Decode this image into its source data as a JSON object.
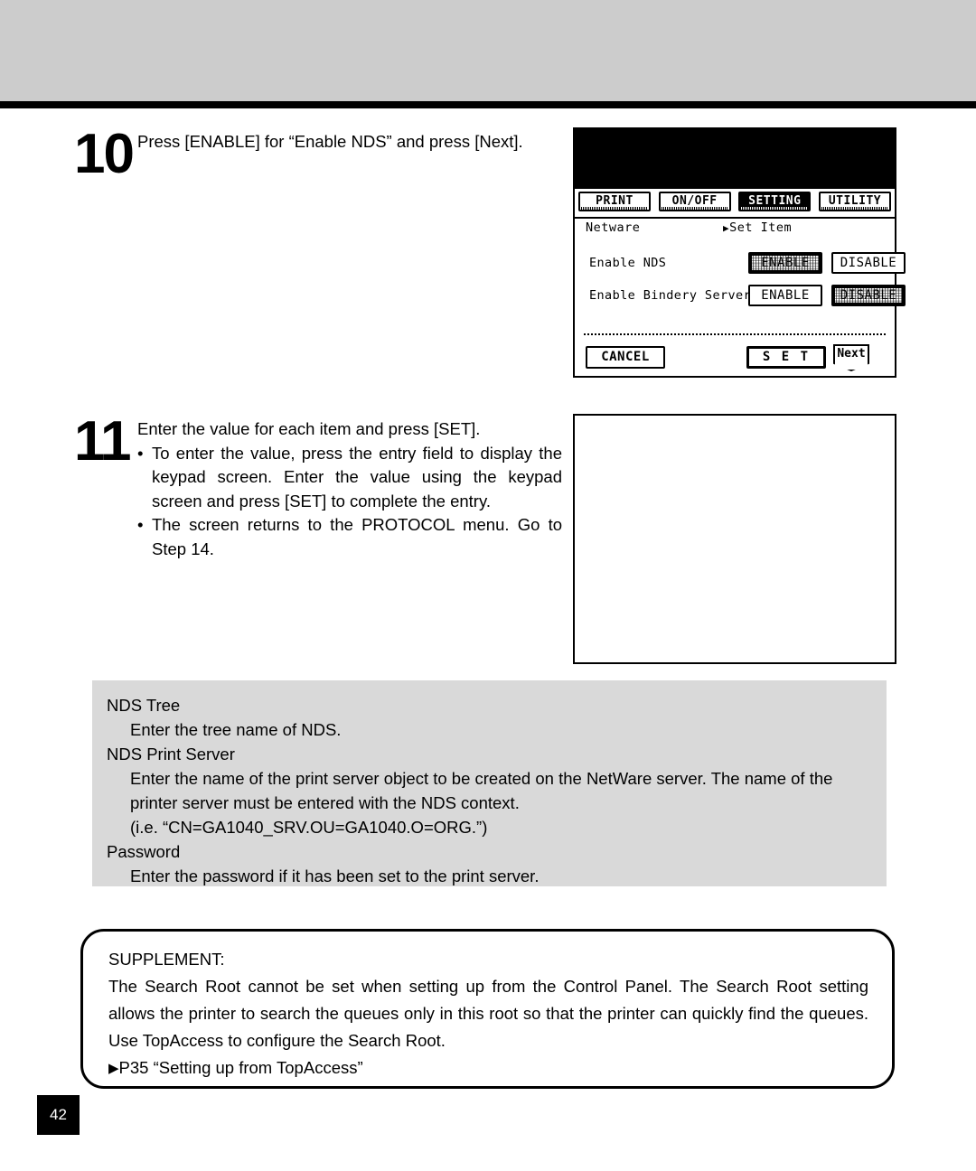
{
  "page": {
    "number": "42"
  },
  "steps": [
    {
      "number": "10",
      "text": "Press [ENABLE] for  “Enable NDS” and press [Next]."
    },
    {
      "number": "11",
      "text": "Enter the value for each item and press [SET].",
      "bullets": [
        "To enter the value, press the entry field to display the keypad screen.  Enter the value using the keypad screen and press [SET] to complete the entry.",
        "The screen returns to the PROTOCOL menu.  Go to Step 14."
      ]
    }
  ],
  "lcd": {
    "tabs": [
      {
        "label": "PRINT",
        "selected": false
      },
      {
        "label": "ON/OFF",
        "selected": false
      },
      {
        "label": "SETTING",
        "selected": true
      },
      {
        "label": "UTILITY",
        "selected": false
      }
    ],
    "breadcrumb": {
      "root": "Netware",
      "arrow": "▶",
      "current": "Set Item"
    },
    "settings": [
      {
        "label": "Enable NDS",
        "options": [
          {
            "label": "ENABLE",
            "selected": true
          },
          {
            "label": "DISABLE",
            "selected": false
          }
        ]
      },
      {
        "label": "Enable Bindery Server",
        "options": [
          {
            "label": "ENABLE",
            "selected": false
          },
          {
            "label": "DISABLE",
            "selected": true
          }
        ]
      }
    ],
    "actions": {
      "cancel": "CANCEL",
      "set": "S E T",
      "next": "Next"
    }
  },
  "definitions": [
    {
      "term": "NDS Tree",
      "desc": "Enter the tree name of NDS."
    },
    {
      "term": "NDS Print Server",
      "desc": "Enter the name of the print server object to be created on the NetWare server.  The name of the printer server must be entered with the NDS context."
    },
    {
      "term": "",
      "desc": "(i.e. “CN=GA1040_SRV.OU=GA1040.O=ORG.”)"
    },
    {
      "term": "Password",
      "desc": "Enter the password if it has been set to the print server."
    }
  ],
  "supplement": {
    "title": "SUPPLEMENT:",
    "body": "The Search Root cannot be set when setting up from the Control Panel.  The Search Root setting allows the printer to search the queues only in this root so that the printer can quickly find the queues.  Use TopAccess to configure the Search Root.",
    "reference_arrow": "▶",
    "reference": "P35 “Setting up from TopAccess”"
  }
}
